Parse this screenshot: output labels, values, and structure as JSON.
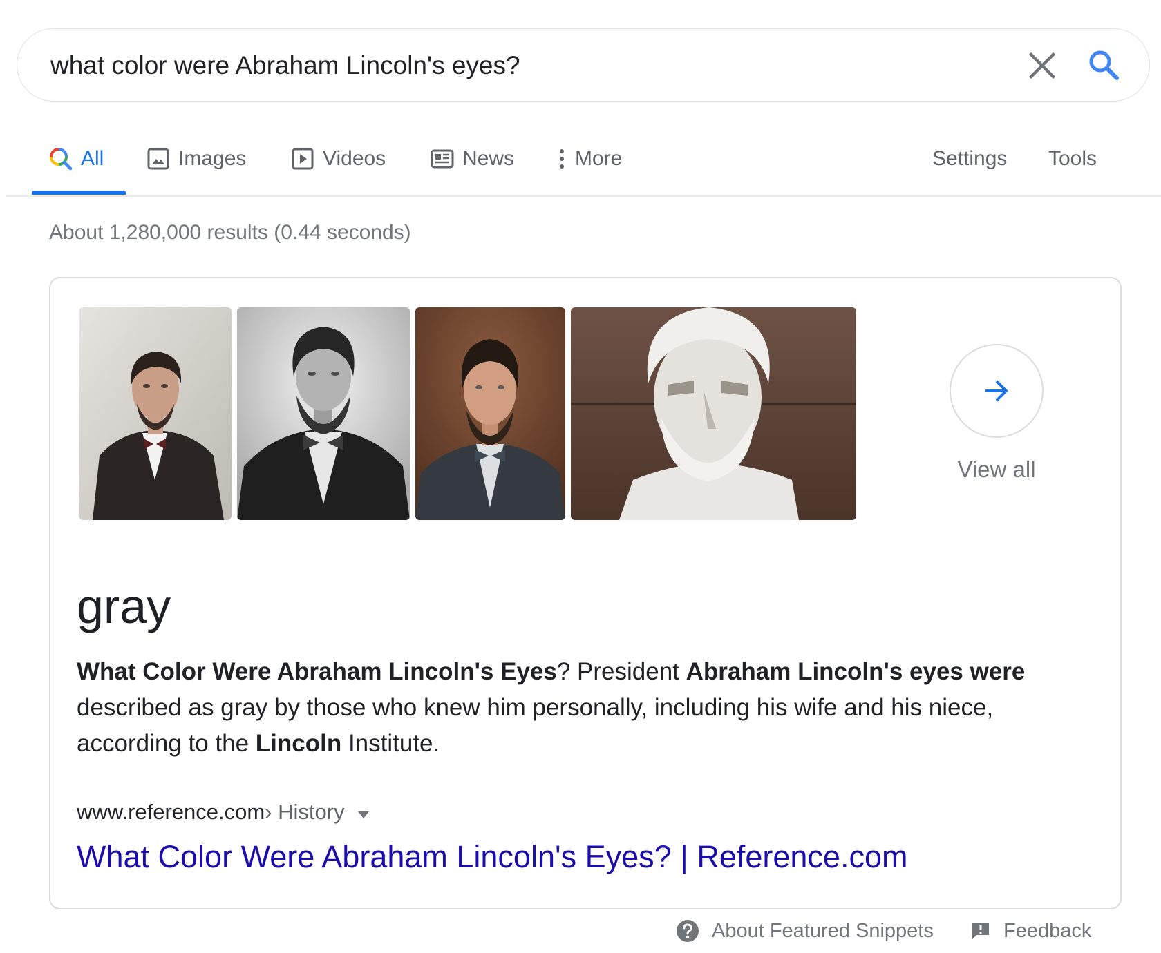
{
  "search": {
    "query": "what color were Abraham Lincoln's eyes?"
  },
  "tabs": [
    {
      "label": "All",
      "icon": "search-icon",
      "active": true
    },
    {
      "label": "Images",
      "icon": "image-icon"
    },
    {
      "label": "Videos",
      "icon": "video-icon"
    },
    {
      "label": "News",
      "icon": "news-icon"
    },
    {
      "label": "More",
      "icon": "more-vert-icon"
    }
  ],
  "tools": {
    "settings": "Settings",
    "tools": "Tools"
  },
  "result_stats": "About 1,280,000 results (0.44 seconds)",
  "snippet": {
    "images": [
      {
        "name": "lincoln-portrait-1",
        "tone": "color"
      },
      {
        "name": "lincoln-portrait-2",
        "tone": "grayscale"
      },
      {
        "name": "lincoln-portrait-3",
        "tone": "color"
      },
      {
        "name": "lincoln-memorial-statue",
        "tone": "marble"
      }
    ],
    "view_all": "View all",
    "answer": "gray",
    "text": {
      "b1": "What Color Were Abraham Lincoln's Eyes",
      "t1": "? President ",
      "b2": "Abraham Lincoln's eyes were",
      "t2": " described as gray by those who knew him personally, including his wife and his niece, according to the ",
      "b3": "Lincoln",
      "t3": " Institute."
    },
    "cite_domain": "www.reference.com",
    "cite_path": " › History",
    "link_title": "What Color Were Abraham Lincoln's Eyes? | Reference.com"
  },
  "footer": {
    "about": "About Featured Snippets",
    "feedback": "Feedback"
  },
  "colors": {
    "accent": "#1a73e8",
    "link": "#1a0dab",
    "muted": "#70757a",
    "text": "#202124"
  }
}
